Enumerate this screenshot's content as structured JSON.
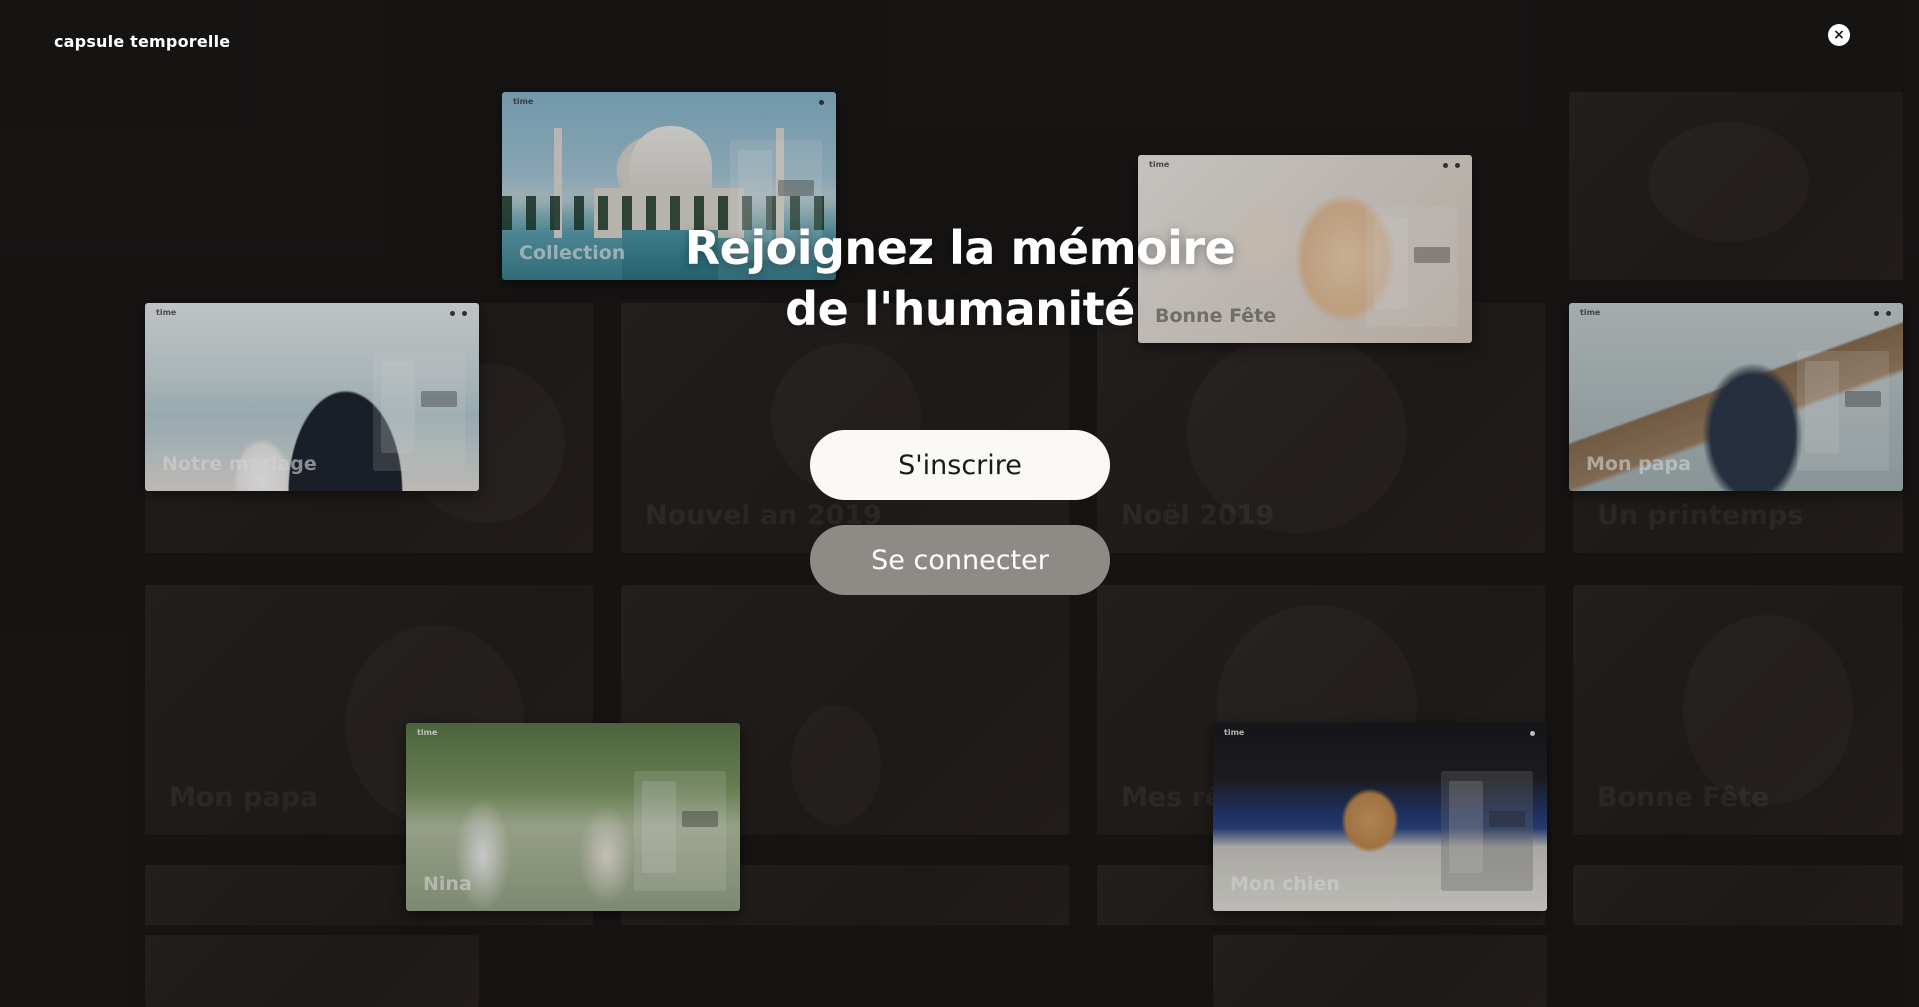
{
  "header": {
    "logo_text": "capsule temporelle",
    "close_symbol": "×"
  },
  "hero": {
    "title_line1": "Rejoignez la mémoire",
    "title_line2": "de l'humanité"
  },
  "buttons": {
    "signup_label": "S'inscrire",
    "login_label": "Se connecter"
  },
  "cards": {
    "mini_logo": "time",
    "featured": [
      {
        "label": "Collection"
      },
      {
        "label": "Bonne Fête"
      },
      {
        "label": "Notre mariage"
      },
      {
        "label": "Mon papa"
      },
      {
        "label": "Nina"
      },
      {
        "label": "Mon chien"
      }
    ],
    "background": [
      {
        "label": "Nouvel an 2019"
      },
      {
        "label": "Noël 2019"
      },
      {
        "label": "Un printemps"
      },
      {
        "label": "Mon papa"
      },
      {
        "label": "Mes rêves"
      },
      {
        "label": "Bonne Fête"
      }
    ]
  },
  "colors": {
    "background": "#1c1818",
    "signup_bg": "#fbf9f5",
    "login_bg": "#8e8b87"
  }
}
